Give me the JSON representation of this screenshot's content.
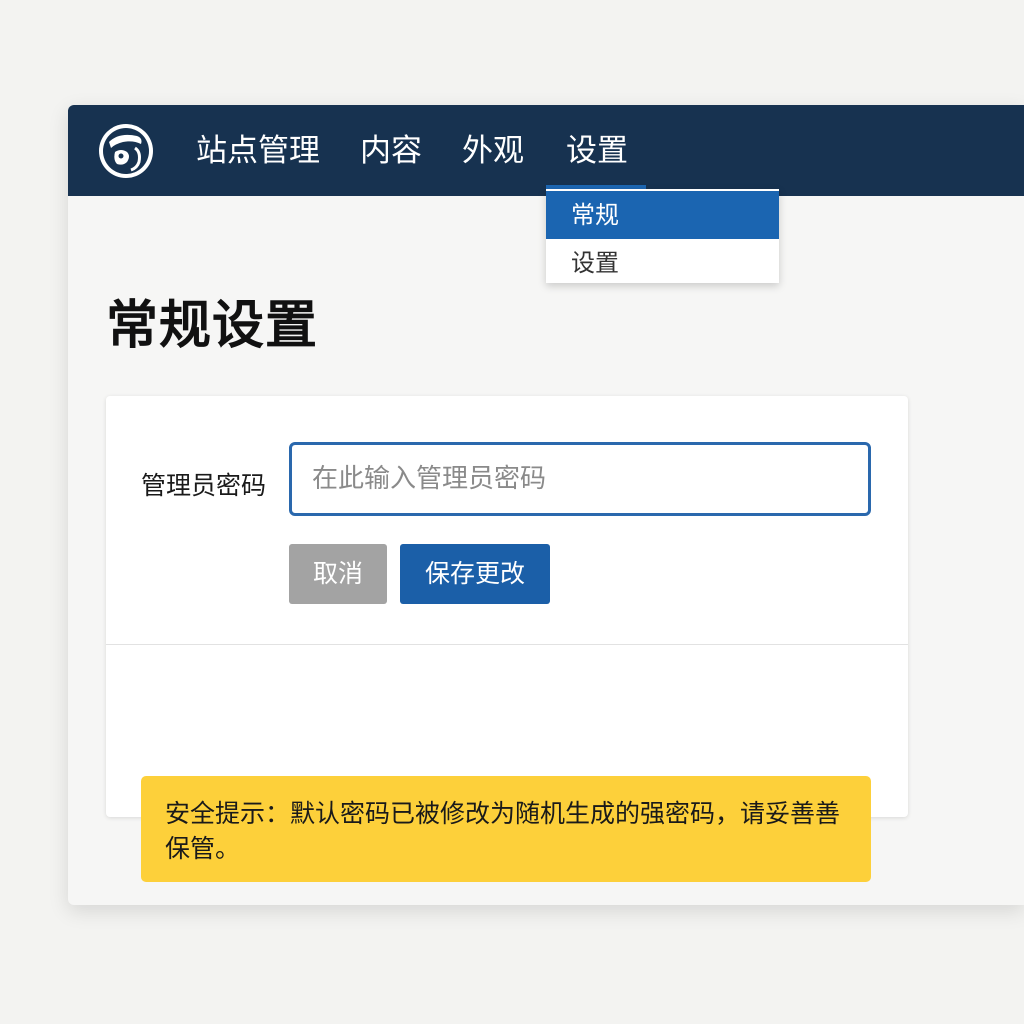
{
  "navbar": {
    "logo_icon": "site-logo-icon",
    "items": [
      {
        "label": "站点管理"
      },
      {
        "label": "内容"
      },
      {
        "label": "外观"
      },
      {
        "label": "设置"
      }
    ],
    "active_index": 3
  },
  "dropdown": {
    "items": [
      {
        "label": "常规",
        "active": true
      },
      {
        "label": "设置",
        "active": false
      }
    ]
  },
  "page": {
    "title": "常规设置"
  },
  "form": {
    "password_label": "管理员密码",
    "password_value": "",
    "password_placeholder": "在此输入管理员密码",
    "cancel_label": "取消",
    "save_label": "保存更改"
  },
  "alert": {
    "text": "安全提示：默认密码已被修改为随机生成的强密码，请妥善善保管。"
  },
  "colors": {
    "navbar_bg": "#173250",
    "accent": "#1b65b1",
    "cancel_bg": "#a3a3a3",
    "alert_bg": "#fdd03a"
  }
}
